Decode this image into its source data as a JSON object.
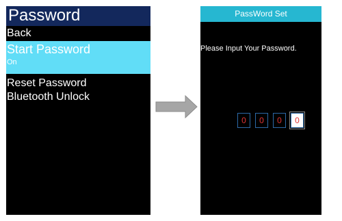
{
  "left_screen": {
    "title": "Password",
    "menu": {
      "back": "Back",
      "start_password": {
        "label": "Start Password",
        "value": "On"
      },
      "reset_password": "Reset Password",
      "bluetooth_unlock": "Bluetooth Unlock"
    },
    "colors": {
      "header_bg": "#13285c",
      "selected_bg": "#61ddf7",
      "screen_bg": "#000000"
    }
  },
  "arrow": {
    "icon": "right-arrow-icon",
    "color": "#9a9a9a"
  },
  "right_screen": {
    "title": "PassWord Set",
    "prompt": "Please Input Your Password.",
    "digits": [
      "0",
      "0",
      "0",
      "0"
    ],
    "active_digit_index": 3,
    "colors": {
      "header_bg": "#26b7d1",
      "digit_text": "#e03434",
      "digit_border": "#2d6aa8"
    }
  }
}
